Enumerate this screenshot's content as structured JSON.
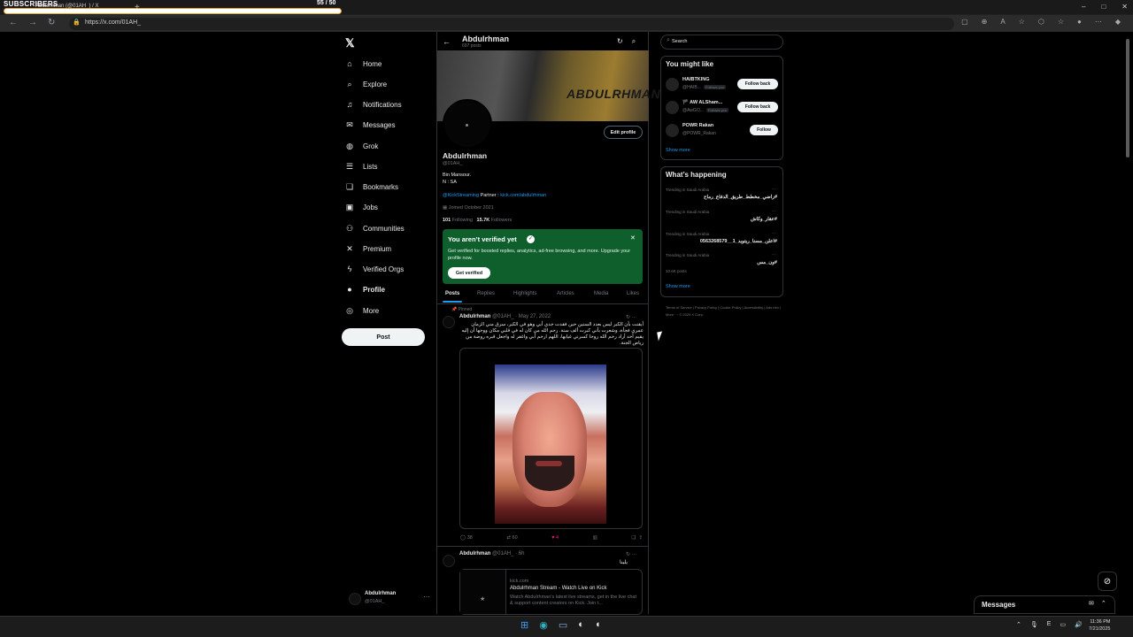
{
  "browser": {
    "overlay_label": "SUBSCRIBERS",
    "overlay_count": "55 / 50",
    "tab_title": "Abdulrhman (@01AH_) / X",
    "url": "https://x.com/01AH_"
  },
  "nav": {
    "items": [
      {
        "label": "Home",
        "icon": "home-icon",
        "glyph": "⌂"
      },
      {
        "label": "Explore",
        "icon": "search-icon",
        "glyph": "⌕"
      },
      {
        "label": "Notifications",
        "icon": "bell-icon",
        "glyph": "♫"
      },
      {
        "label": "Messages",
        "icon": "mail-icon",
        "glyph": "✉"
      },
      {
        "label": "Grok",
        "icon": "grok-icon",
        "glyph": "◍"
      },
      {
        "label": "Lists",
        "icon": "lists-icon",
        "glyph": "☰"
      },
      {
        "label": "Bookmarks",
        "icon": "bookmark-icon",
        "glyph": "❏"
      },
      {
        "label": "Jobs",
        "icon": "briefcase-icon",
        "glyph": "▣"
      },
      {
        "label": "Communities",
        "icon": "communities-icon",
        "glyph": "⚇"
      },
      {
        "label": "Premium",
        "icon": "x-logo-icon",
        "glyph": "✕"
      },
      {
        "label": "Verified Orgs",
        "icon": "lightning-icon",
        "glyph": "ϟ"
      },
      {
        "label": "Profile",
        "icon": "person-icon",
        "glyph": "●"
      },
      {
        "label": "More",
        "icon": "more-circle-icon",
        "glyph": "◎"
      }
    ],
    "post_label": "Post",
    "account_name": "Abdulrhman",
    "account_handle": "@01AH_"
  },
  "header": {
    "name": "Abdulrhman",
    "posts": "697 posts"
  },
  "profile": {
    "banner_text": "ABDULRHMAN",
    "edit_label": "Edit profile",
    "name": "Abdulrhman",
    "handle": "@01AH_",
    "bio_line1": "Bin Mansour.",
    "bio_line2": "N : SA",
    "link_kick": "@KickStreaming",
    "partner_text": " Partner : ",
    "link_url": "kick.com/abdulrhman",
    "joined": "Joined October 2021",
    "following_count": "101",
    "following_label": "Following",
    "followers_count": "15.7K",
    "followers_label": "Followers"
  },
  "verify_banner": {
    "title": "You aren’t verified yet",
    "desc": "Get verified for boosted replies, analytics, ad-free browsing, and more. Upgrade your profile now.",
    "button": "Get verified"
  },
  "tabs": [
    "Posts",
    "Replies",
    "Highlights",
    "Articles",
    "Media",
    "Likes"
  ],
  "post1": {
    "pinned": "Pinned",
    "name": "Abdulrhman",
    "meta": "@01AH_ · May 27, 2022",
    "text": "أيقنت بأن الكبر ليس بعدد السنين حين فقدت جدي أبي وهو في الكبر، سرق مني الزمان عمري فجأة، وشعرت بأني كبرت ألف سنة. رحم الله من كان له في قلبي مكان ووجها أن إليه يقيم أحد أراد رحم الله روحا كسرني غيابها، اللهم ارحم أبي واغفر له واجعل قبره روضة من رياض الجنة.",
    "replies": "38",
    "reposts": "60",
    "likes": "4"
  },
  "post2": {
    "name": "Abdulrhman",
    "meta": "@01AH_ · 6h",
    "text": "يلينا",
    "card_domain": "kick.com",
    "card_title": "Abdulrhman Stream - Watch Live on Kick",
    "card_desc": "Watch Abdulrhman's latest live streams, get in the live chat & support content creators on Kick. Join t..."
  },
  "sidebar": {
    "search_placeholder": "Search",
    "ymlk_title": "You might like",
    "suggestions": [
      {
        "name": "HAIBTKING",
        "handle": "@HAIB...",
        "badge": "Follows you",
        "button": "Follow back"
      },
      {
        "name": "🏴 AW ALSham...",
        "handle": "@AwGO...",
        "badge": "Follows you",
        "button": "Follow back"
      },
      {
        "name": "POWR Rakan",
        "handle": "@POWR_Rakan",
        "badge": "",
        "button": "Follow"
      }
    ],
    "show_more": "Show more",
    "whap_title": "What’s happening",
    "trends": [
      {
        "context": "Trending in Saudi Arabia",
        "topic": "#راضي_مخطط_طريق_الدفاع_رماح"
      },
      {
        "context": "Trending in Saudi Arabia",
        "topic": "#عقار_وكاش"
      },
      {
        "context": "Trending in Saudi Arabia",
        "topic": "#اعلن_مسنا_ريتويد_1__0563268579"
      },
      {
        "context": "Trending in Saudi Arabia",
        "topic": "#ون_مس"
      }
    ],
    "trend_posts": "10.6K posts",
    "show_more2": "Show more",
    "footer": "Terms of Service | Privacy Policy | Cookie Policy | Accessibility | Ads info | More ··· © 2025 X Corp."
  },
  "messages_drawer": {
    "title": "Messages"
  },
  "clock": {
    "time": "11:36 PM",
    "date": "7/21/2025"
  }
}
